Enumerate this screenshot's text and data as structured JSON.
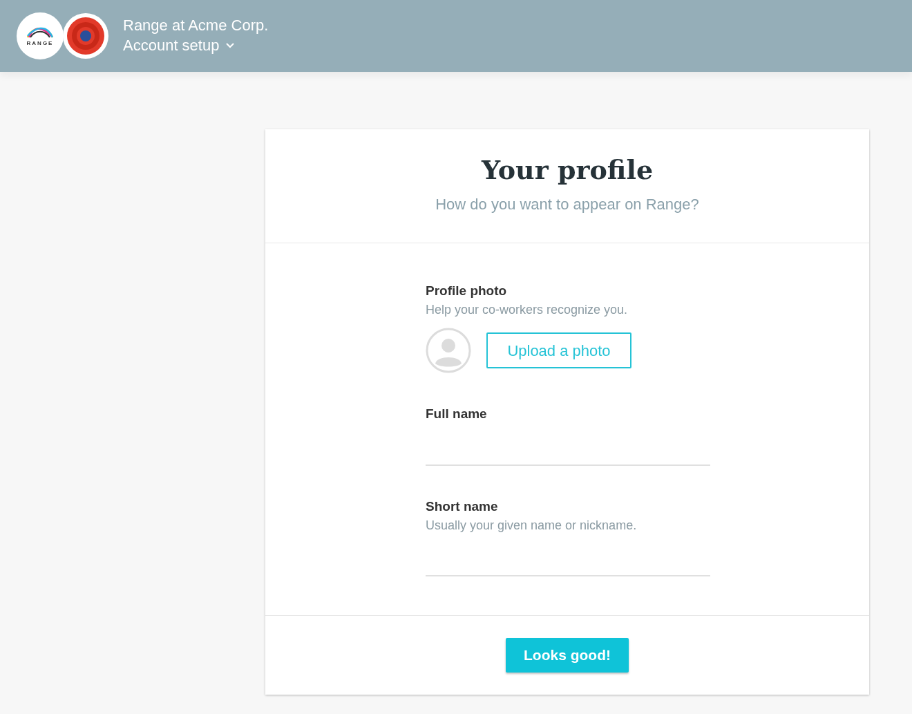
{
  "header": {
    "logo_text": "RANGE",
    "title": "Range at Acme Corp.",
    "subtitle": "Account setup"
  },
  "card": {
    "title": "Your profile",
    "subtitle": "How do you want to appear on Range?",
    "photo": {
      "label": "Profile photo",
      "hint": "Help your co-workers recognize you.",
      "button": "Upload a photo"
    },
    "fields": [
      {
        "label": "Full name"
      },
      {
        "label": "Short name",
        "hint": "Usually your given name or nickname."
      }
    ],
    "submit": "Looks good!"
  }
}
